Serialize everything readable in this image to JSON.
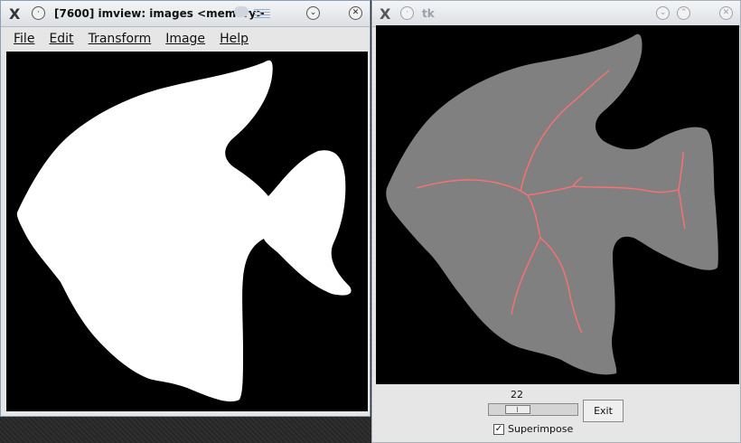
{
  "window_left": {
    "title": "[7600] imview: images <memory>",
    "menu": [
      "File",
      "Edit",
      "Transform",
      "Image",
      "Help"
    ],
    "icons": [
      "app-icon",
      "sticky-icon",
      "menu-dropdown-icon",
      "close-icon"
    ],
    "image": {
      "kind": "binary mask",
      "foreground": "#ffffff",
      "background": "#000000"
    }
  },
  "window_right": {
    "title": "tk",
    "icons": [
      "app-icon",
      "sticky-icon",
      "minimize-icon",
      "maximize-icon",
      "close-icon"
    ],
    "image": {
      "kind": "skeleton overlay",
      "fill": "#808080",
      "skeleton": "#ff7070",
      "background": "#000000"
    },
    "slider": {
      "value": "22",
      "fraction": 0.25
    },
    "exit_label": "Exit",
    "superimpose": {
      "label": "Superimpose",
      "checked": true,
      "mark": "✓"
    }
  }
}
